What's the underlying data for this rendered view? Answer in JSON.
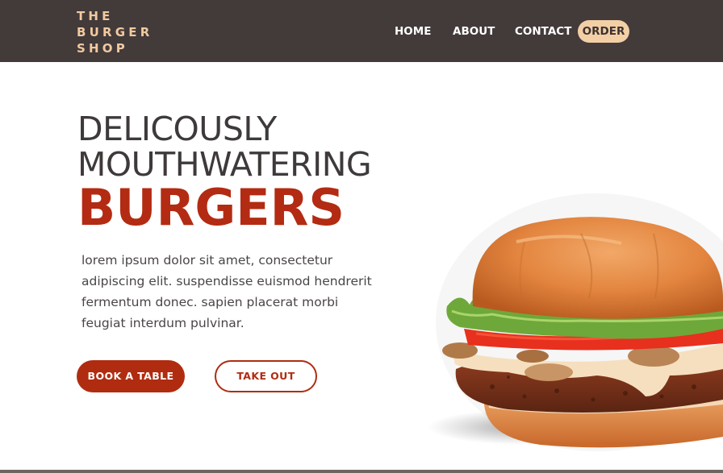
{
  "brand": {
    "line1": "THE",
    "line2": "BURGER",
    "line3": "SHOP"
  },
  "nav": {
    "home": "HOME",
    "about": "ABOUT",
    "contact": "CONTACT",
    "order": "ORDER"
  },
  "hero": {
    "line1": "DELICOUSLY",
    "line2": "MOUTHWATERING",
    "line3": "BURGERS",
    "description": "lorem ipsum dolor sit amet, consectetur adipiscing elit. suspendisse euismod hendrerit fermentum donec. sapien placerat morbi feugiat interdum pulvinar.",
    "book_label": "BOOK A TABLE",
    "takeout_label": "TAKE OUT"
  },
  "colors": {
    "header_bg": "#433a3a",
    "brand_accent": "#f1caa0",
    "primary": "#b02c10",
    "heading_text": "#3f3a3a"
  },
  "icons": {
    "hero_image": "burger-illustration"
  }
}
